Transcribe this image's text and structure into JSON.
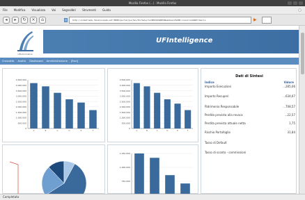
{
  "window": {
    "title": "Mozilla Firefox (...) · Mozilla Firefox"
  },
  "menubar": {
    "items": [
      "File",
      "Modifica",
      "Visualizza",
      "Vai",
      "Segnalibri",
      "Strumenti",
      "Guida"
    ]
  },
  "navbar": {
    "url": "http://ermatrade.fanalisiweb.net:8080/portal/portal/Portale/?u=B5434%2DE2Nashboard%2D0:concorso%2DPrimario"
  },
  "app": {
    "brand": "UFIntelligence",
    "logo_caption": "UFlnformatica",
    "tabs": [
      "Cruscotto",
      "Analisi",
      "Dashboard",
      "Amministrazione",
      "[Esci]"
    ],
    "accent": "#3d6ea3"
  },
  "summary": {
    "title": "Dati di Sintesi",
    "col_label": "Indice",
    "col_value": "Valore",
    "rows": [
      {
        "label": "Importo Esecuzioni",
        "value": "...285,06"
      },
      {
        "label": "Importo Recuperi",
        "value": "...634,67"
      },
      {
        "label": "Patrimonio Responsabile",
        "value": "...708,57"
      },
      {
        "label": "Perdita prevista alla revoca",
        "value": "...22,57"
      },
      {
        "label": "Perdita prevista attuale netta",
        "value": "1,75"
      },
      {
        "label": "Rischio Portafoglio",
        "value": "31,84"
      },
      {
        "label": "Tasso di Default",
        "value": ""
      },
      {
        "label": "Tasso di sconto - commissioni",
        "value": ""
      }
    ]
  },
  "chart_data": [
    {
      "type": "bar",
      "categories": [
        "A",
        "B",
        "C",
        "D",
        "E",
        "F"
      ],
      "values": [
        4200000,
        3900000,
        3300000,
        2700000,
        2400000,
        1700000
      ],
      "ylim": [
        0,
        4500000
      ],
      "yticks": [
        "4.500.000",
        "4.000.000",
        "3.500.000",
        "3.000.000",
        "2.500.000",
        "2.000.000",
        "1.500.000",
        "1.000.000",
        "500.000",
        "0"
      ],
      "color": "#3a6a9c"
    },
    {
      "type": "bar",
      "categories": [
        "A",
        "B",
        "C",
        "D",
        "E",
        "F"
      ],
      "values": [
        4200000,
        3900000,
        3300000,
        2700000,
        2300000,
        1700000
      ],
      "ylim": [
        0,
        4500000
      ],
      "yticks": [
        "4.500.000",
        "4.000.000",
        "3.500.000",
        "3.000.000",
        "2.500.000",
        "2.000.000",
        "1.500.000",
        "1.000.000",
        "500.000",
        "0"
      ],
      "color": "#3a6a9c"
    },
    {
      "type": "pie",
      "values": [
        58,
        22,
        12,
        8
      ],
      "colors": [
        "#3a6a9c",
        "#6f9fd0",
        "#1d4a7a",
        "#a9c7e6"
      ]
    },
    {
      "type": "bar",
      "categories": [
        "A",
        "B",
        "C",
        "D"
      ],
      "values": [
        1280000,
        1120000,
        600000,
        350000
      ],
      "ylim": [
        0,
        1250000
      ],
      "yticks": [
        "1.250.000",
        "1.000.000",
        "750.000",
        "500.000"
      ],
      "color": "#3a6a9c"
    }
  ],
  "status": {
    "text": "Completato"
  }
}
